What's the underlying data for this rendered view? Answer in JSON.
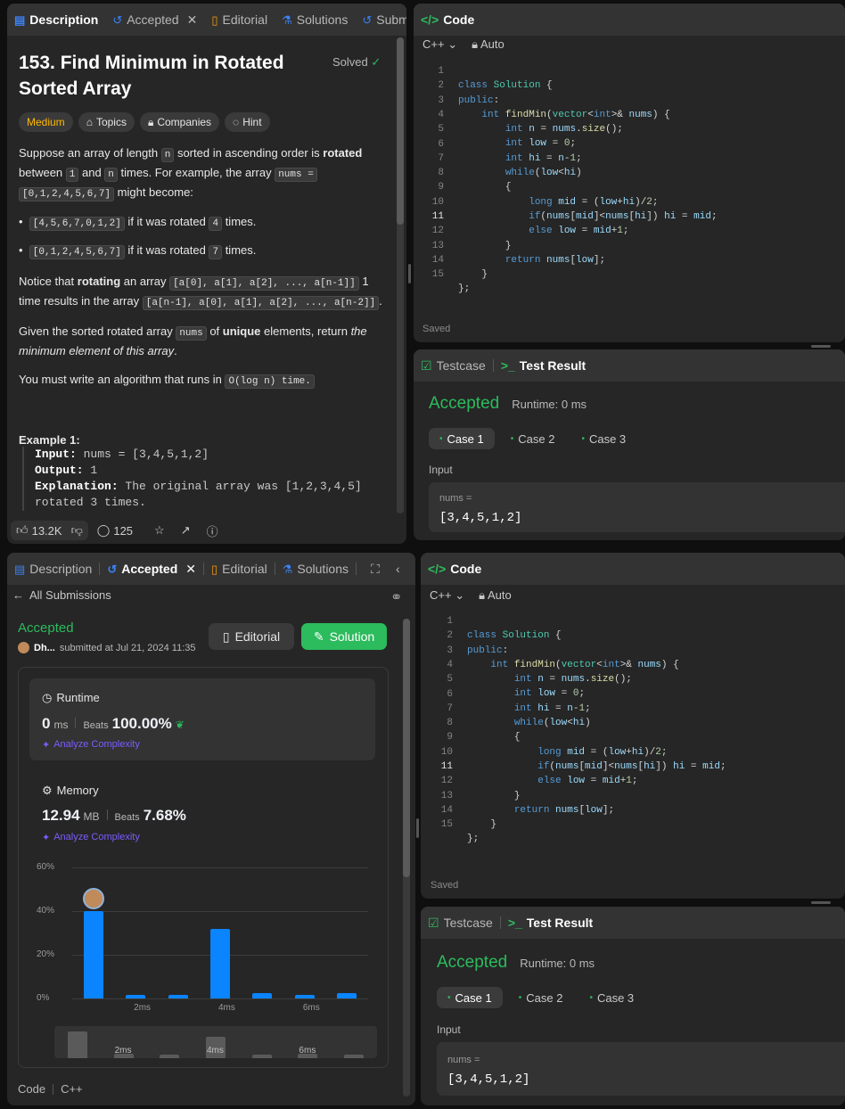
{
  "left_top": {
    "tabs": [
      "Description",
      "Accepted",
      "Editorial",
      "Solutions",
      "Submi"
    ],
    "title_line1": "153. Find Minimum in Rotated",
    "title_line2": "Sorted Array",
    "solved": "Solved",
    "chips": [
      "Medium",
      "Topics",
      "Companies",
      "Hint"
    ],
    "p1": {
      "a": "Suppose an array of length ",
      "c1": "n",
      "b": " sorted in ascending order is ",
      "bold": "rotated",
      "d": "between ",
      "c2": "1",
      "e": " and ",
      "c3": "n",
      "f": " times. For example, the array ",
      "c4": "nums =",
      "c5": "[0,1,2,4,5,6,7]",
      "g": " might become:"
    },
    "bullets": [
      {
        "code": "[4,5,6,7,0,1,2]",
        "text": " if it was rotated ",
        "n": "4",
        "end": " times."
      },
      {
        "code": "[0,1,2,4,5,6,7]",
        "text": " if it was rotated ",
        "n": "7",
        "end": " times."
      }
    ],
    "p2": {
      "a": "Notice that ",
      "bold": "rotating",
      "b": " an array ",
      "c1": "[a[0], a[1], a[2], ..., a[n-1]]",
      "c": " 1",
      "d": "time results in the array ",
      "c2": "[a[n-1], a[0], a[1], a[2], ..., a[n-2]]",
      "e": "."
    },
    "p3": {
      "a": "Given the sorted rotated array ",
      "c1": "nums",
      "b": " of ",
      "bold": "unique",
      "c": " elements, return ",
      "it1": "the",
      "it2": "minimum element of this array",
      "d": "."
    },
    "p4": {
      "a": "You must write an algorithm that runs in ",
      "c1": "O(log n) time."
    },
    "example_title": "Example 1:",
    "ex_input_label": "Input:",
    "ex_input": " nums = [3,4,5,1,2]",
    "ex_output_label": "Output:",
    "ex_output": " 1",
    "ex_expl_label": "Explanation:",
    "ex_expl": " The original array was [1,2,3,4,5]",
    "ex_expl2": "rotated 3 times.",
    "likes": "13.2K",
    "comments": "125"
  },
  "code_panel": {
    "title": "Code",
    "lang": "C++",
    "auto": "Auto",
    "saved": "Saved",
    "line_numbers": [
      "1",
      "2",
      "3",
      "4",
      "5",
      "6",
      "7",
      "8",
      "9",
      "10",
      "11",
      "12",
      "13",
      "14",
      "15"
    ]
  },
  "result_panel": {
    "tab_testcase": "Testcase",
    "tab_result": "Test Result",
    "status": "Accepted",
    "runtime": "Runtime: 0 ms",
    "cases": [
      "Case 1",
      "Case 2",
      "Case 3"
    ],
    "input_label": "Input",
    "var": "nums =",
    "value": "[3,4,5,1,2]"
  },
  "left_bottom": {
    "tabs": [
      "Description",
      "Accepted",
      "Editorial",
      "Solutions"
    ],
    "back": "All Submissions",
    "status": "Accepted",
    "user": "Dh...",
    "submitted": "submitted at Jul 21, 2024 11:35",
    "editorial_btn": "Editorial",
    "solution_btn": "Solution",
    "runtime_label": "Runtime",
    "runtime_val": "0",
    "runtime_unit": "ms",
    "beats": "Beats",
    "runtime_beats": "100.00%",
    "analyze": "Analyze Complexity",
    "memory_label": "Memory",
    "memory_val": "12.94",
    "memory_unit": "MB",
    "memory_beats": "7.68%",
    "footer": [
      "Code",
      "C++"
    ]
  },
  "chart_data": {
    "type": "bar",
    "ylim": [
      0,
      60
    ],
    "yticks": [
      "60%",
      "40%",
      "20%",
      "0%"
    ],
    "xticks": [
      "2ms",
      "4ms",
      "6ms"
    ],
    "values": [
      40,
      1.5,
      1.5,
      32,
      2.5,
      1.5,
      2.5
    ],
    "mini_values": [
      30,
      5,
      0,
      24,
      0,
      5,
      0
    ]
  },
  "colors": {
    "accent_green": "#2cbb5d",
    "bar_blue": "#0a84ff",
    "medium": "#ffb800"
  }
}
